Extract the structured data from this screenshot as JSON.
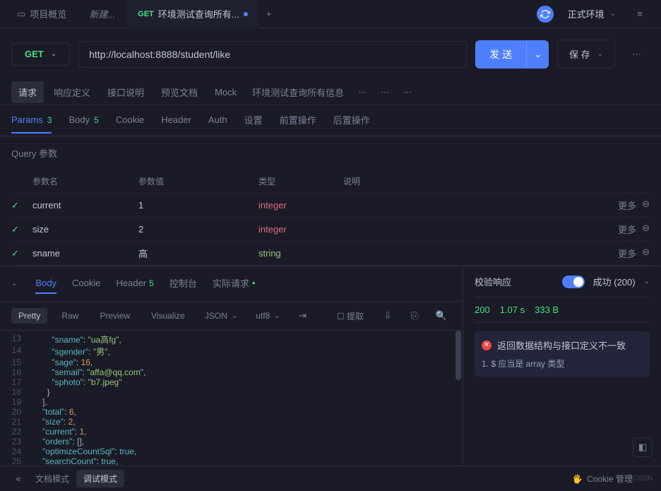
{
  "topbar": {
    "overview": "项目概览",
    "new_tab": "新建...",
    "active_tab": {
      "method": "GET",
      "title": "环境测试查询所有..."
    },
    "env_label": "正式环境"
  },
  "url_row": {
    "method": "GET",
    "url": "http://localhost:8888/student/like",
    "send": "发 送",
    "save": "保 存"
  },
  "sub_tabs": [
    "请求",
    "响应定义",
    "接口说明",
    "预览文档",
    "Mock"
  ],
  "breadcrumb": "环境测试查询所有信息",
  "param_tabs": [
    {
      "label": "Params",
      "badge": "3"
    },
    {
      "label": "Body",
      "badge": "5"
    },
    {
      "label": "Cookie"
    },
    {
      "label": "Header"
    },
    {
      "label": "Auth"
    },
    {
      "label": "设置"
    },
    {
      "label": "前置操作"
    },
    {
      "label": "后置操作"
    }
  ],
  "query_title": "Query 参数",
  "param_headers": {
    "name": "参数名",
    "value": "参数值",
    "type": "类型",
    "desc": "说明"
  },
  "params": [
    {
      "name": "current",
      "value": "1",
      "type": "integer",
      "more": "更多"
    },
    {
      "name": "size",
      "value": "2",
      "type": "integer",
      "more": "更多"
    },
    {
      "name": "sname",
      "value": "高",
      "type": "string",
      "more": "更多"
    }
  ],
  "resp_tabs": [
    {
      "label": "Body"
    },
    {
      "label": "Cookie"
    },
    {
      "label": "Header",
      "badge": "5"
    },
    {
      "label": "控制台"
    },
    {
      "label": "实际请求",
      "dot": true
    }
  ],
  "resp_toolbar": {
    "pretty": "Pretty",
    "raw": "Raw",
    "preview": "Preview",
    "visualize": "Visualize",
    "format": "JSON",
    "encoding": "utf8",
    "extract": "提取"
  },
  "code": [
    {
      "n": 13,
      "indent": 10,
      "tokens": [
        {
          "k": "key",
          "v": "\"sname\""
        },
        {
          "k": "punc",
          "v": ": "
        },
        {
          "k": "str",
          "v": "\"ua高fg\""
        },
        {
          "k": "punc",
          "v": ","
        }
      ]
    },
    {
      "n": 14,
      "indent": 10,
      "tokens": [
        {
          "k": "key",
          "v": "\"sgender\""
        },
        {
          "k": "punc",
          "v": ": "
        },
        {
          "k": "str",
          "v": "\"男\""
        },
        {
          "k": "punc",
          "v": ","
        }
      ]
    },
    {
      "n": 15,
      "indent": 10,
      "tokens": [
        {
          "k": "key",
          "v": "\"sage\""
        },
        {
          "k": "punc",
          "v": ": "
        },
        {
          "k": "num",
          "v": "16"
        },
        {
          "k": "punc",
          "v": ","
        }
      ]
    },
    {
      "n": 16,
      "indent": 10,
      "tokens": [
        {
          "k": "key",
          "v": "\"semail\""
        },
        {
          "k": "punc",
          "v": ": "
        },
        {
          "k": "str",
          "v": "\"affa@qq.com\""
        },
        {
          "k": "punc",
          "v": ","
        }
      ]
    },
    {
      "n": 17,
      "indent": 10,
      "tokens": [
        {
          "k": "key",
          "v": "\"sphoto\""
        },
        {
          "k": "punc",
          "v": ": "
        },
        {
          "k": "str",
          "v": "\"b7.jpeg\""
        }
      ]
    },
    {
      "n": 18,
      "indent": 8,
      "tokens": [
        {
          "k": "punc",
          "v": "}"
        }
      ]
    },
    {
      "n": 19,
      "indent": 6,
      "tokens": [
        {
          "k": "punc",
          "v": "],"
        }
      ]
    },
    {
      "n": 20,
      "indent": 6,
      "tokens": [
        {
          "k": "key",
          "v": "\"total\""
        },
        {
          "k": "punc",
          "v": ": "
        },
        {
          "k": "num",
          "v": "6"
        },
        {
          "k": "punc",
          "v": ","
        }
      ]
    },
    {
      "n": 21,
      "indent": 6,
      "tokens": [
        {
          "k": "key",
          "v": "\"size\""
        },
        {
          "k": "punc",
          "v": ": "
        },
        {
          "k": "num",
          "v": "2"
        },
        {
          "k": "punc",
          "v": ","
        }
      ]
    },
    {
      "n": 22,
      "indent": 6,
      "tokens": [
        {
          "k": "key",
          "v": "\"current\""
        },
        {
          "k": "punc",
          "v": ": "
        },
        {
          "k": "num",
          "v": "1"
        },
        {
          "k": "punc",
          "v": ","
        }
      ]
    },
    {
      "n": 23,
      "indent": 6,
      "tokens": [
        {
          "k": "key",
          "v": "\"orders\""
        },
        {
          "k": "punc",
          "v": ": [],"
        }
      ]
    },
    {
      "n": 24,
      "indent": 6,
      "tokens": [
        {
          "k": "key",
          "v": "\"optimizeCountSql\""
        },
        {
          "k": "punc",
          "v": ": "
        },
        {
          "k": "bool",
          "v": "true"
        },
        {
          "k": "punc",
          "v": ","
        }
      ]
    },
    {
      "n": 25,
      "indent": 6,
      "tokens": [
        {
          "k": "key",
          "v": "\"searchCount\""
        },
        {
          "k": "punc",
          "v": ": "
        },
        {
          "k": "bool",
          "v": "true"
        },
        {
          "k": "punc",
          "v": ","
        }
      ]
    }
  ],
  "validate": {
    "label": "校验响应",
    "status": "成功 (200)"
  },
  "status": {
    "code": "200",
    "time": "1.07 s",
    "size": "333 B"
  },
  "error": {
    "title": "返回数据结构与接口定义不一致",
    "detail": "1. $ 应当是 array 类型"
  },
  "bottom": {
    "doc_mode": "文档模式",
    "debug_mode": "调试模式",
    "cookie": "Cookie 管理"
  }
}
